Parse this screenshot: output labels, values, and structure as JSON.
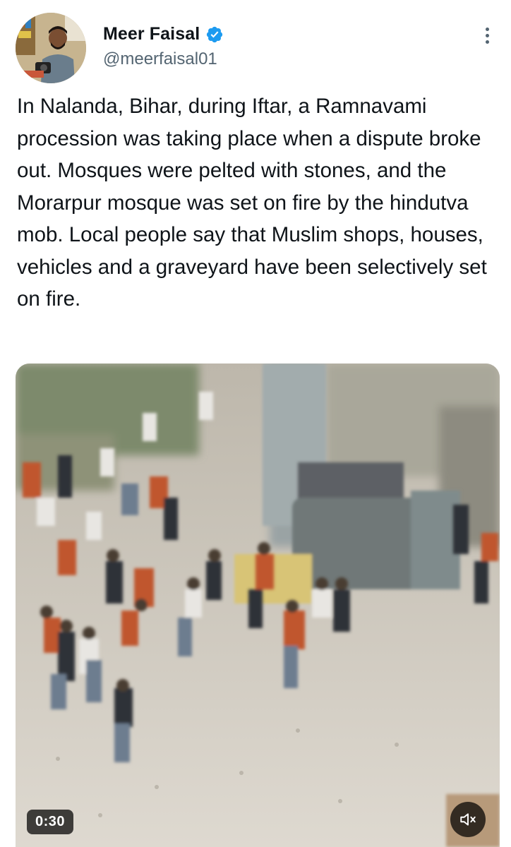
{
  "author": {
    "display_name": "Meer Faisal",
    "handle": "@meerfaisal01",
    "verified": true
  },
  "tweet": {
    "text": "In Nalanda, Bihar, during Iftar, a Ramnavami procession was taking place when a dispute broke out. Mosques were pelted with stones, and the Morarpur mosque was set on fire by the hindutva mob. Local people say that Muslim shops, houses, vehicles and a graveyard have been selectively set on fire."
  },
  "media": {
    "type": "video",
    "duration": "0:30",
    "muted": true
  },
  "icons": {
    "verified": "verified-badge-icon",
    "more": "more-options-icon",
    "mute": "speaker-muted-icon"
  },
  "colors": {
    "verified_blue": "#1d9bf0",
    "text_primary": "#0f1419",
    "text_secondary": "#536471"
  }
}
